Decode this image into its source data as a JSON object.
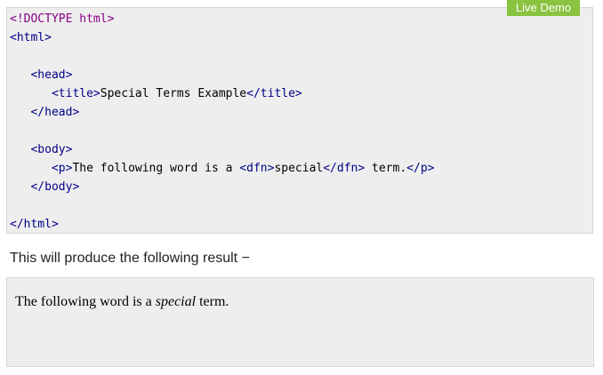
{
  "live_demo": {
    "label": "Live Demo",
    "color": "#8ac33f"
  },
  "code": {
    "background": "#eeeeee",
    "lines": [
      {
        "doctype": "<!DOCTYPE html>"
      },
      {
        "tag": "<html>"
      },
      {},
      {
        "tag": "<head>"
      },
      {
        "open": "<title>",
        "text": "Special Terms Example",
        "close": "</title>"
      },
      {
        "tag": "</head>"
      },
      {},
      {
        "tag": "<body>"
      },
      {
        "open": "<p>",
        "text": "The following word is a ",
        "open2": "<dfn>",
        "text2": "special",
        "close2": "</dfn>",
        "text3": " term.",
        "close": "</p>"
      },
      {
        "tag": "</body>"
      },
      {},
      {
        "tag": "</html>"
      }
    ]
  },
  "result_intro": "This will produce the following result −",
  "result": {
    "before": "The following word is a ",
    "dfn": "special",
    "after": " term."
  }
}
